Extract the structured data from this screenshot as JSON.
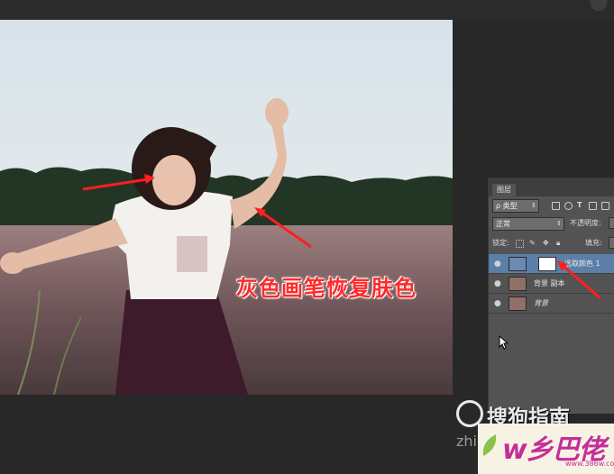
{
  "annotation": {
    "text": "灰色画笔恢复肤色"
  },
  "layers_panel": {
    "tab_label": "图层",
    "filter_kind": "ρ 类型",
    "blend_mode": "正常",
    "opacity_label": "不透明度:",
    "lock_label": "锁定:",
    "fill_label": "填充:",
    "layers": [
      {
        "name": "选取颜色 1",
        "active": true
      },
      {
        "name": "背景 副本",
        "active": false
      },
      {
        "name": "背景",
        "active": false
      }
    ]
  },
  "watermark": {
    "sogou": "搜狗指南",
    "zhi": "zhi",
    "site_logo": "w乡巴佬",
    "site_url": "www.386w.com"
  },
  "colors": {
    "annotation_red": "#ff2a2a",
    "selected_layer": "#5b7fa8",
    "watermark_magenta": "#c42e99"
  }
}
